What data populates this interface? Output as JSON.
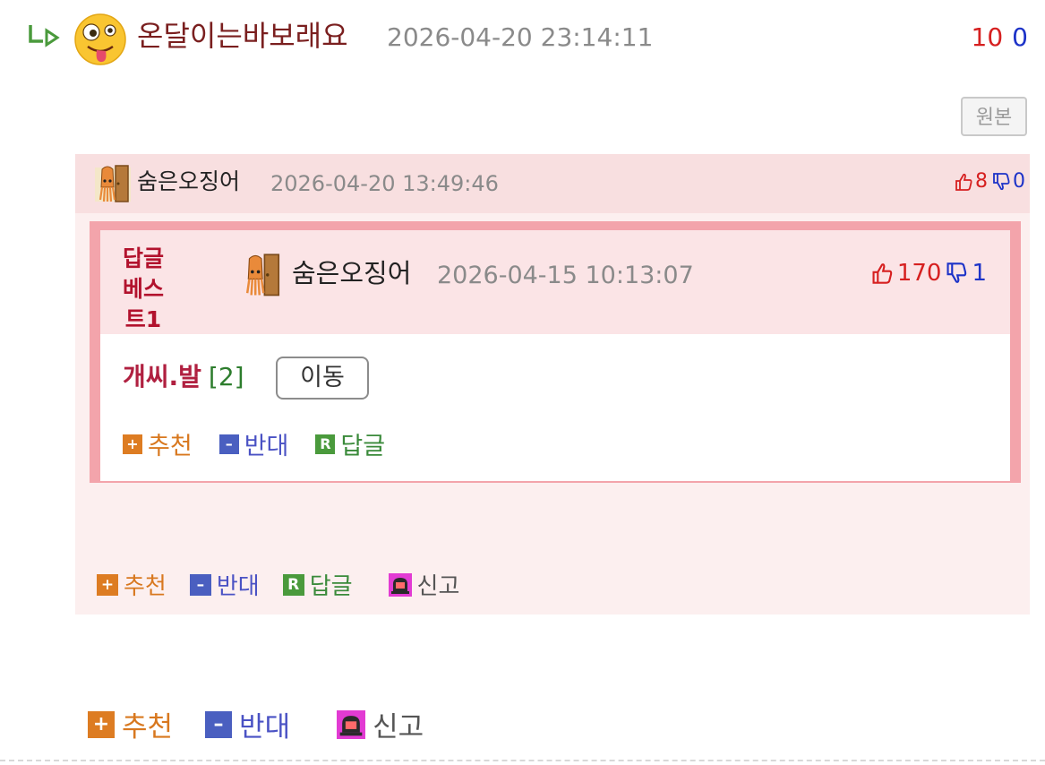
{
  "reply": {
    "nickname": "온달이는바보래요",
    "datetime": "2026-04-20 23:14:11",
    "upvotes": "10",
    "downvotes": "0"
  },
  "original_button": "원본",
  "quoted": {
    "nickname": "숨은오징어",
    "datetime": "2026-04-20 13:49:46",
    "upvotes": "8",
    "downvotes": "0",
    "best_reply": {
      "label_line1": "답글",
      "label_line2": "베스트1",
      "nickname": "숨은오징어",
      "datetime": "2026-04-15 10:13:07",
      "upvotes": "170",
      "downvotes": "1",
      "text": "개씨.발",
      "reply_count": "[2]",
      "move_button": "이동",
      "actions": {
        "recommend": "추천",
        "oppose": "반대",
        "reply": "답글"
      }
    },
    "actions": {
      "recommend": "추천",
      "oppose": "반대",
      "reply": "답글",
      "report": "신고"
    }
  },
  "bottom_actions": {
    "recommend": "추천",
    "oppose": "반대",
    "report": "신고"
  },
  "icons": {
    "reply_arrow": "reply-arrow-icon",
    "emoji": "zany-face-icon",
    "avatar": "squid-avatar-icon",
    "thumb_up": "thumb-up-icon",
    "thumb_down": "thumb-down-icon",
    "report": "siren-icon"
  },
  "colors": {
    "upvote": "#d62020",
    "downvote": "#1d33c8",
    "recommend": "#dd7c22",
    "oppose": "#4a5fc0",
    "reply": "#4a9a3c",
    "best_border": "#f3a4ab"
  }
}
